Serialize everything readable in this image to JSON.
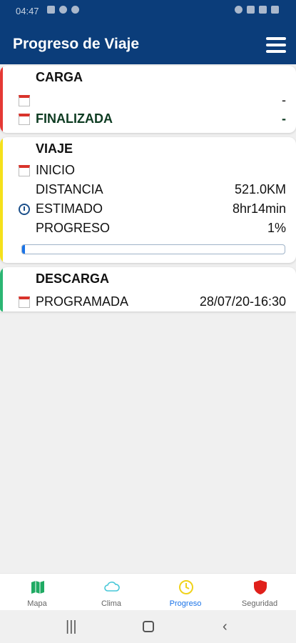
{
  "status_bar": {
    "time": "04:47"
  },
  "app_bar": {
    "title": "Progreso de Viaje"
  },
  "cards": {
    "carga": {
      "title": "CARGA",
      "rows": [
        {
          "label": "",
          "value": "-"
        },
        {
          "label": "FINALIZADA",
          "value": "-"
        }
      ],
      "accent": "#e53935"
    },
    "viaje": {
      "title": "VIAJE",
      "rows": [
        {
          "label": "INICIO",
          "value": ""
        },
        {
          "label": "DISTANCIA",
          "value": "521.0KM"
        },
        {
          "label": "ESTIMADO",
          "value": "8hr14min"
        },
        {
          "label": "PROGRESO",
          "value": "1%"
        }
      ],
      "progress": 0.01,
      "accent": "#f5e11b"
    },
    "descarga": {
      "title": "DESCARGA",
      "rows": [
        {
          "label": "PROGRAMADA",
          "value": "28/07/20-16:30"
        }
      ],
      "accent": "#2bb673"
    }
  },
  "bottom_nav": [
    {
      "label": "Mapa",
      "icon": "map-icon",
      "color": "#1faa63",
      "active": false
    },
    {
      "label": "Clima",
      "icon": "cloud-icon",
      "color": "#47c7d8",
      "active": false
    },
    {
      "label": "Progreso",
      "icon": "clock-icon",
      "color": "#f0d21a",
      "active": true
    },
    {
      "label": "Seguridad",
      "icon": "shield-icon",
      "color": "#e0201b",
      "active": false
    }
  ],
  "colors": {
    "primary": "#0b3d7a",
    "active_tab": "#1a73e8"
  }
}
